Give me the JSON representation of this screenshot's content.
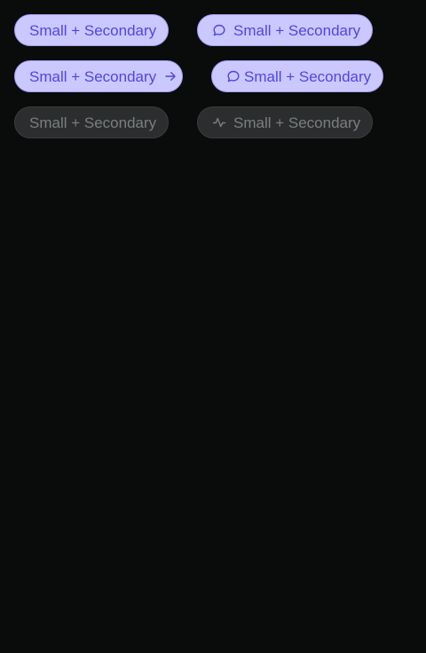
{
  "colors": {
    "page_background": "#0a0c0c",
    "active_background": "#cbc8ff",
    "active_border": "#a59ef4",
    "active_text": "#4f46e5",
    "disabled_background": "#2b2d2e",
    "disabled_text": "#7b7f81"
  },
  "buttons": [
    {
      "label": "Small + Secondary",
      "state": "enabled",
      "icon": "none"
    },
    {
      "label": "Small + Secondary",
      "state": "enabled",
      "icon": "chat-bubble-icon",
      "icon_position": "leading"
    },
    {
      "label": "Small + Secondary",
      "state": "enabled",
      "icon": "arrow-right-icon",
      "icon_position": "trailing"
    },
    {
      "label": "Small + Secondary",
      "state": "enabled",
      "icon": "chat-bubble-icon",
      "icon_position": "leading"
    },
    {
      "label": "Small + Secondary",
      "state": "disabled",
      "icon": "none"
    },
    {
      "label": "Small + Secondary",
      "state": "disabled",
      "icon": "activity-pulse-icon",
      "icon_position": "leading"
    }
  ]
}
